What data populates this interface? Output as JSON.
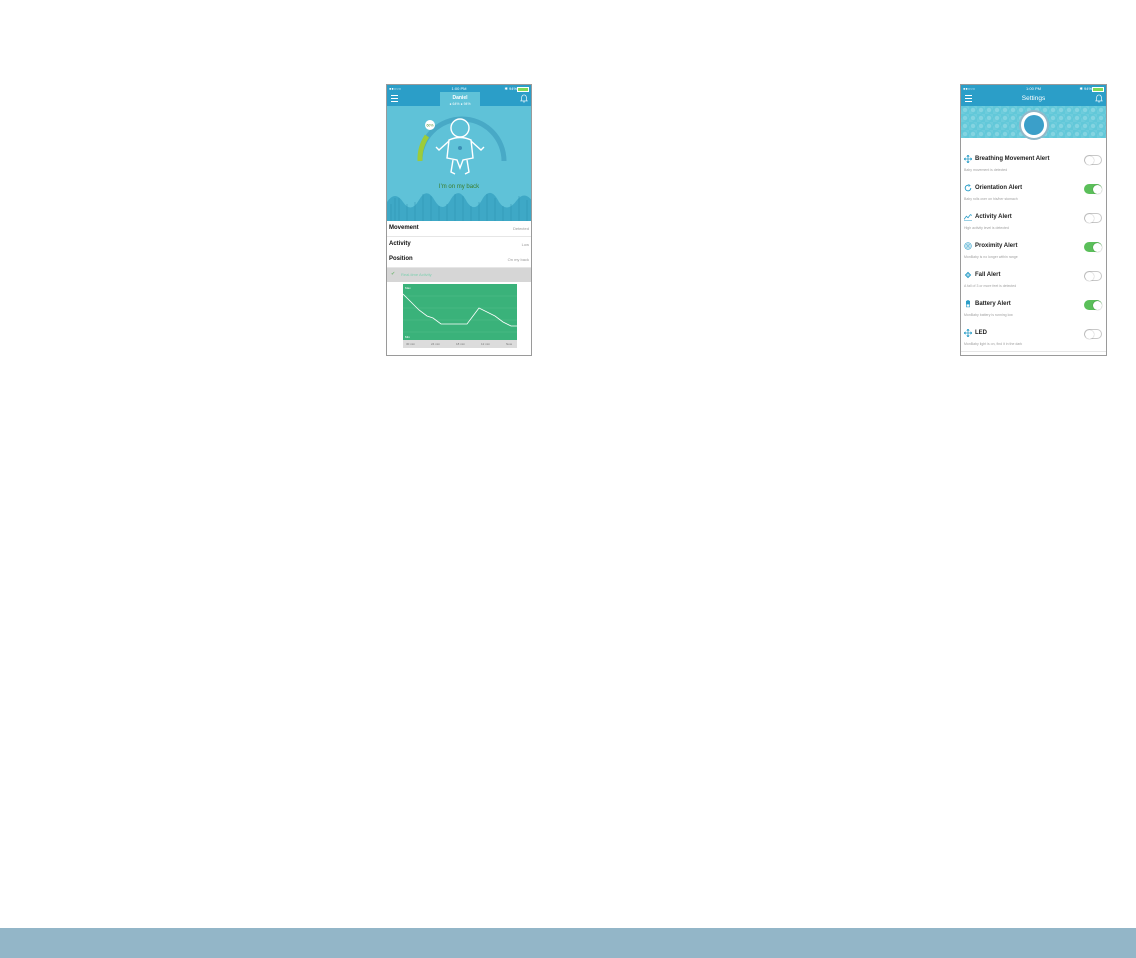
{
  "phone1": {
    "status": {
      "signal": "●●○○○",
      "time": "1:00 PM",
      "battery": "✱ 94%"
    },
    "profile": {
      "name": "Daniel",
      "stats": "● 64%   ● 94%"
    },
    "gauge_badge": "60%",
    "caption": "I'm on my back",
    "metrics": [
      {
        "label": "Movement",
        "value": "Detected"
      },
      {
        "label": "Activity",
        "value": "Low"
      },
      {
        "label": "Position",
        "value": "On my back"
      }
    ],
    "history_label": "Real-time Activity",
    "chart": {
      "top_label": "Max",
      "bottom_label": "Min",
      "x_labels": [
        "30 min",
        "24 min",
        "18 min",
        "12 min",
        "Now"
      ]
    }
  },
  "phone2": {
    "status": {
      "signal": "●●○○○",
      "time": "1:00 PM",
      "battery": "✱ 94%"
    },
    "title": "Settings",
    "settings": [
      {
        "title": "Breathing Movement Alert",
        "desc": "Baby movement is detected",
        "on": false,
        "icon": "move-arrows-icon"
      },
      {
        "title": "Orientation Alert",
        "desc": "Baby rolls over on his/her stomach",
        "on": true,
        "icon": "rotate-icon"
      },
      {
        "title": "Activity Alert",
        "desc": "High activity level is detected",
        "on": false,
        "icon": "activity-icon"
      },
      {
        "title": "Proximity Alert",
        "desc": "MonBaby is no longer within range",
        "on": true,
        "icon": "proximity-icon"
      },
      {
        "title": "Fall Alert",
        "desc": "A fall of 3 or more feet is detected",
        "on": false,
        "icon": "fall-icon"
      },
      {
        "title": "Battery Alert",
        "desc": "MonBaby battery is running low",
        "on": true,
        "icon": "battery-icon"
      },
      {
        "title": "LED",
        "desc": "MonBaby light is on, find it in the dark",
        "on": false,
        "icon": "led-icon"
      }
    ]
  },
  "colors": {
    "primary": "#2b9ec8",
    "hero": "#5fc2d8",
    "toggle_on": "#5bbf5a",
    "chart_bg": "#3ab27a",
    "band": "#93b6c8"
  }
}
